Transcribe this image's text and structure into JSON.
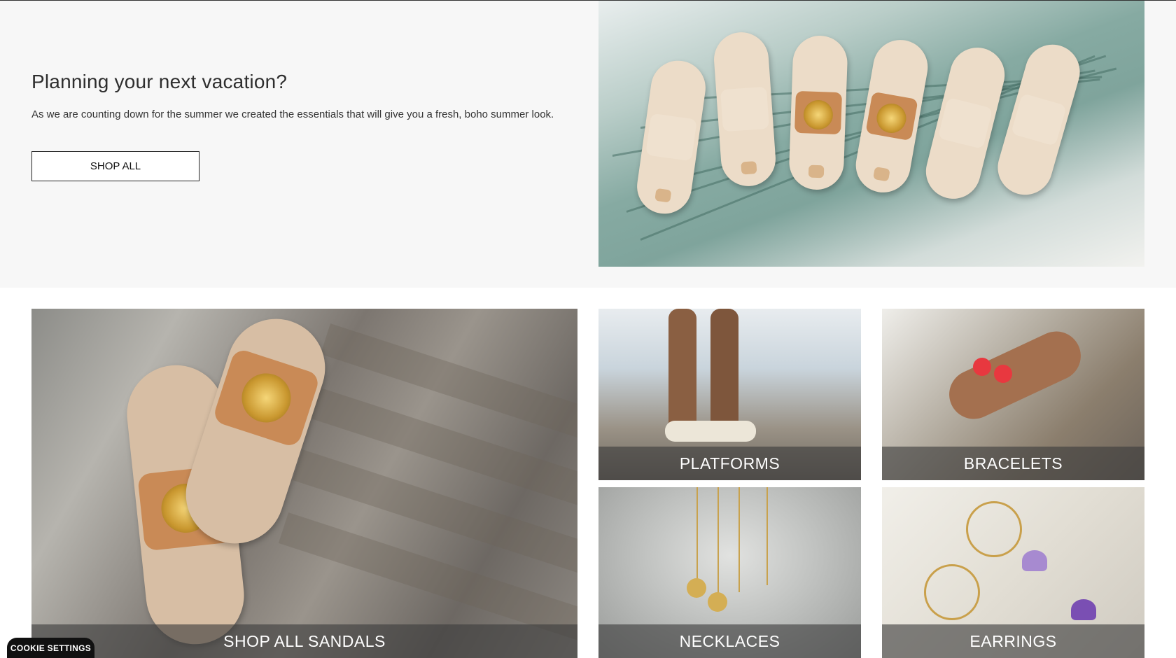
{
  "hero": {
    "title": "Planning your next vacation?",
    "description": "As we are counting down for the summer we created the essentials that will give you a fresh, boho summer look.",
    "button_label": "SHOP ALL"
  },
  "categories": {
    "sandals": "SHOP ALL SANDALS",
    "platforms": "PLATFORMS",
    "bracelets": "BRACELETS",
    "necklaces": "NECKLACES",
    "earrings": "EARRINGS"
  },
  "cookie": {
    "label": "COOKIE SETTINGS"
  },
  "colors": {
    "hero_background": "#f7f7f7",
    "caption_overlay": "rgba(60,60,60,0.62)",
    "cookie_background": "#111111"
  }
}
